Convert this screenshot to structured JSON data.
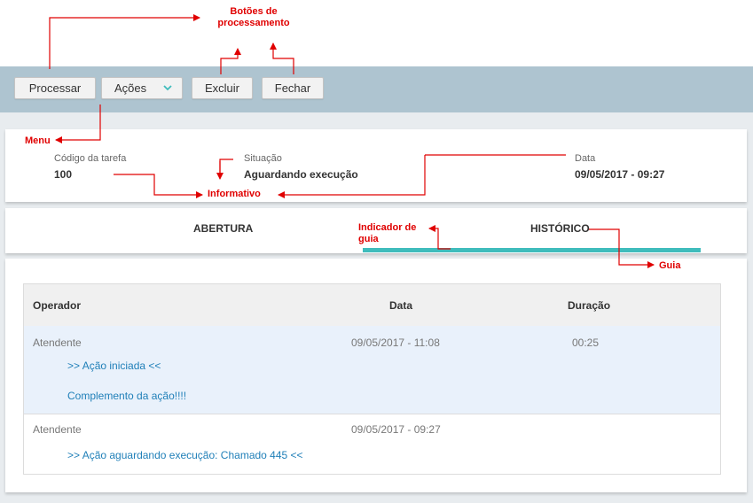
{
  "toolbar": {
    "process_label": "Processar",
    "actions_label": "Ações",
    "delete_label": "Excluir",
    "close_label": "Fechar",
    "accent_color": "#3fbcbc"
  },
  "info": {
    "code_label": "Código da tarefa",
    "code_value": "100",
    "status_label": "Situação",
    "status_value": "Aguardando execução",
    "date_label": "Data",
    "date_value": "09/05/2017 - 09:27"
  },
  "tabs": {
    "opening_label": "ABERTURA",
    "history_label": "HISTÓRICO",
    "active": "HISTÓRICO"
  },
  "table": {
    "headers": [
      "Operador",
      "Data",
      "Duração"
    ],
    "rows": [
      {
        "operator": "Atendente",
        "date": "09/05/2017 - 11:08",
        "duration": "00:25",
        "lines": [
          ">> Ação iniciada <<",
          "Complemento da ação!!!!"
        ]
      },
      {
        "operator": "Atendente",
        "date": "09/05/2017 - 09:27",
        "duration": "",
        "lines": [
          ">> Ação aguardando execução: Chamado 445 <<"
        ]
      }
    ]
  },
  "annotations": {
    "processing_buttons": "Botões de processamento",
    "menu": "Menu",
    "informative": "Informativo",
    "tab_indicator": "Indicador de guia",
    "tab": "Guia",
    "color": "#e00000"
  }
}
